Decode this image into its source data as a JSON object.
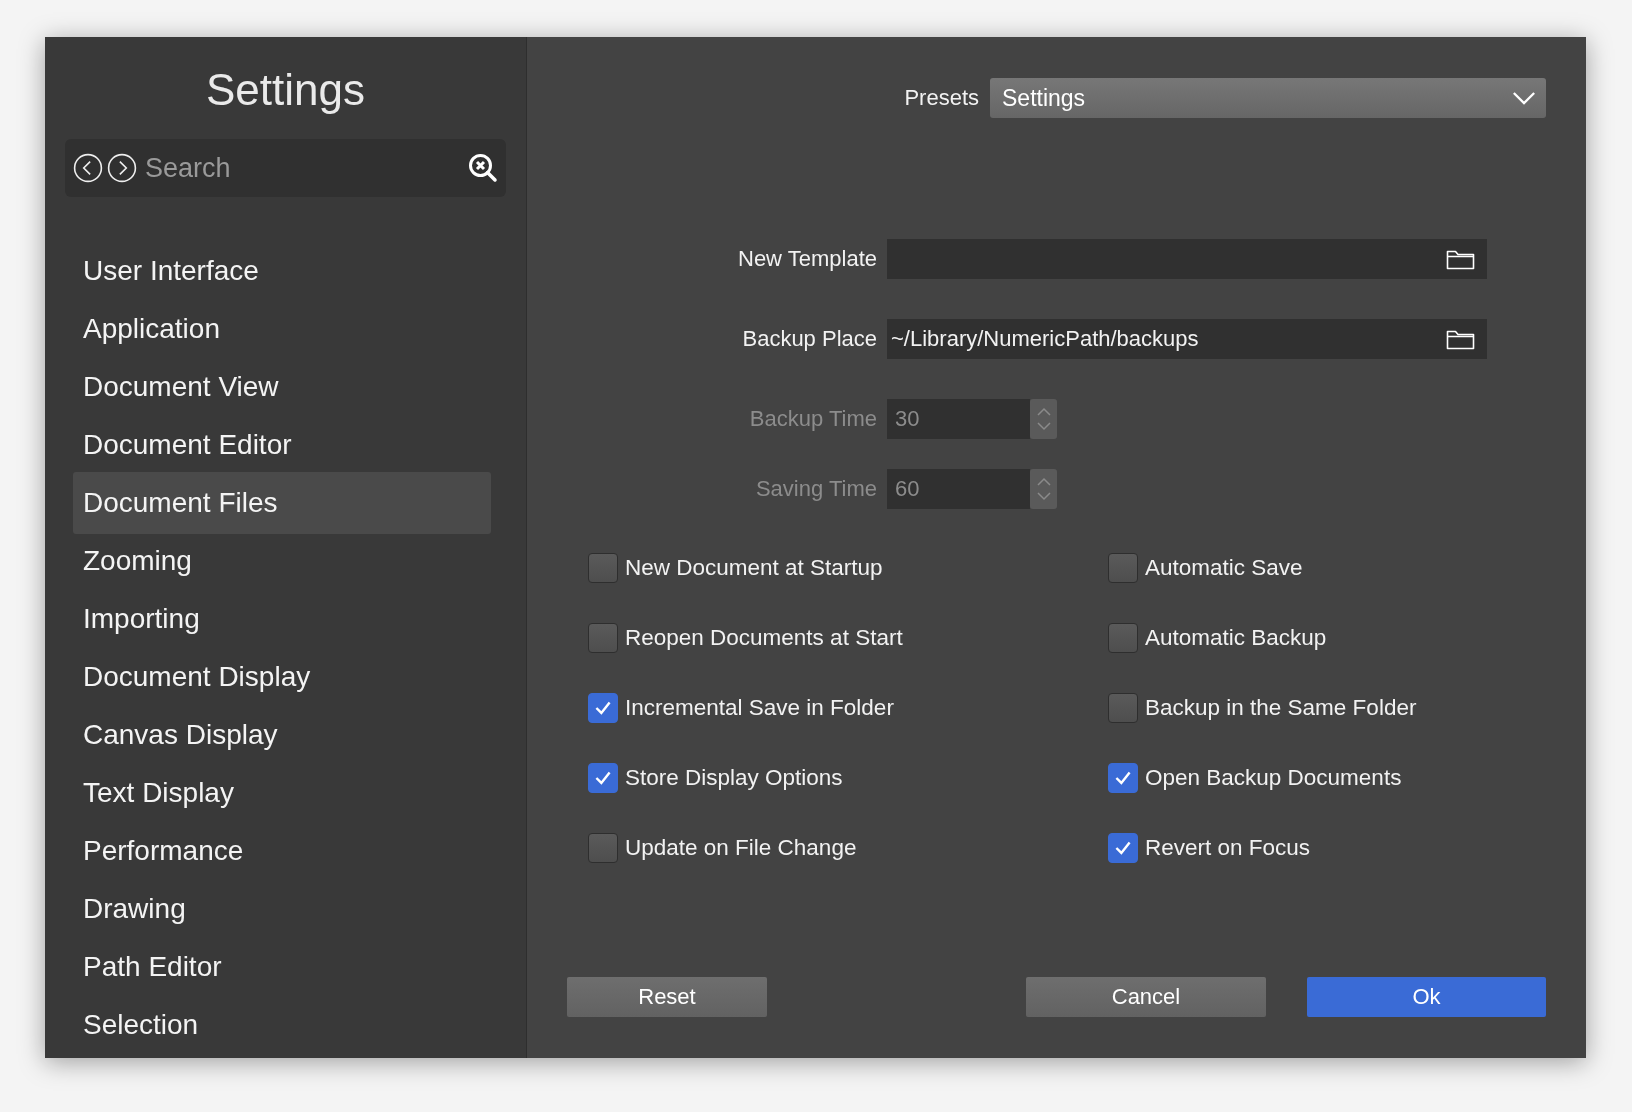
{
  "sidebar": {
    "title": "Settings",
    "search": {
      "placeholder": "Search"
    },
    "items": [
      {
        "label": "User Interface",
        "selected": false
      },
      {
        "label": "Application",
        "selected": false
      },
      {
        "label": "Document View",
        "selected": false
      },
      {
        "label": "Document Editor",
        "selected": false
      },
      {
        "label": "Document Files",
        "selected": true
      },
      {
        "label": "Zooming",
        "selected": false
      },
      {
        "label": "Importing",
        "selected": false
      },
      {
        "label": "Document Display",
        "selected": false
      },
      {
        "label": "Canvas Display",
        "selected": false
      },
      {
        "label": "Text Display",
        "selected": false
      },
      {
        "label": "Performance",
        "selected": false
      },
      {
        "label": "Drawing",
        "selected": false
      },
      {
        "label": "Path Editor",
        "selected": false
      },
      {
        "label": "Selection",
        "selected": false
      }
    ]
  },
  "presets": {
    "label": "Presets",
    "value": "Settings"
  },
  "fields": [
    {
      "kind": "path",
      "label": "New Template",
      "disabled": false
    },
    {
      "kind": "path",
      "label": "Backup Place",
      "value": "~/Library/NumericPath/backups",
      "disabled": false
    },
    {
      "kind": "number",
      "label": "Backup Time",
      "value": "30",
      "disabled": true
    },
    {
      "kind": "number",
      "label": "Saving Time",
      "value": "60",
      "disabled": true
    }
  ],
  "option_columns": [
    [
      {
        "label": "New Document at Startup",
        "checked": false
      },
      {
        "label": "Reopen Documents at Start",
        "checked": false
      },
      {
        "label": "Incremental Save in Folder",
        "checked": true
      },
      {
        "label": "Store Display Options",
        "checked": true
      },
      {
        "label": "Update on File Change",
        "checked": false
      }
    ],
    [
      {
        "label": "Automatic Save",
        "checked": false
      },
      {
        "label": "Automatic Backup",
        "checked": false
      },
      {
        "label": "Backup in the Same Folder",
        "checked": false
      },
      {
        "label": "Open Backup Documents",
        "checked": true
      },
      {
        "label": "Revert on Focus",
        "checked": true
      }
    ]
  ],
  "buttons": [
    {
      "label": "Reset",
      "kind": "plain"
    },
    {
      "label": "Cancel",
      "kind": "plain"
    },
    {
      "label": "Ok",
      "kind": "primary"
    }
  ]
}
